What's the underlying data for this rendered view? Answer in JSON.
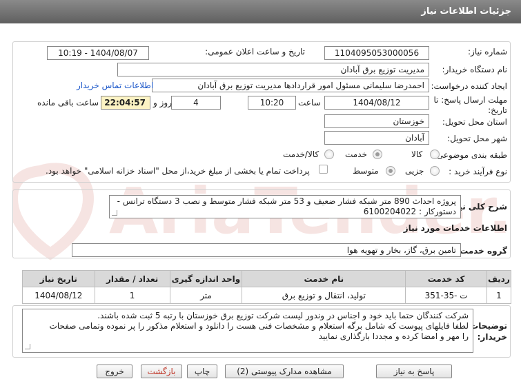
{
  "title": "جزئیات اطلاعات نیاز",
  "fields": {
    "need_number_label": "شماره نیاز:",
    "need_number": "1104095053000056",
    "announce_label": "تاریخ و ساعت اعلان عمومی:",
    "announce_value": "1404/08/07 - 10:19",
    "buyer_org_label": "نام دستگاه خریدار:",
    "buyer_org": "مدیریت توزیع برق آبادان",
    "creator_label": "ایجاد کننده درخواست:",
    "creator": "احمدرضا سلیمانی مسئول امور قراردادها مدیریت توزیع برق آبادان",
    "contact_link": "اطلاعات تماس خریدار",
    "deadline_label": "مهلت ارسال پاسخ: تا تاریخ:",
    "deadline_date": "1404/08/12",
    "hour_label": "ساعت",
    "deadline_time": "10:20",
    "days": "4",
    "days_label": "روز و",
    "remaining": "22:04:57",
    "remaining_label": "ساعت باقی مانده",
    "province_label": "استان محل تحویل:",
    "province": "خوزستان",
    "city_label": "شهر محل تحویل:",
    "city": "آبادان",
    "category_label": "طبقه بندی موضوعی:",
    "category_options": [
      "کالا",
      "خدمت",
      "کالا/خدمت"
    ],
    "category_selected": "خدمت",
    "process_label": "نوع فرآیند خرید :",
    "process_options": [
      "جزیی",
      "متوسط"
    ],
    "process_selected": "متوسط",
    "payment_note": "پرداخت تمام یا بخشی از مبلغ خرید،از محل \"اسناد خزانه اسلامی\" خواهد بود."
  },
  "summary": {
    "label": "شرح کلی نیاز:",
    "text": "پروژه احداث 890 متر شبکه فشار ضعیف و 53 متر شبکه فشار متوسط و نصب 3 دستگاه ترانس - دستورکار : 6100204022"
  },
  "services_header": "اطلاعات خدمات مورد نیاز",
  "service_group_label": "گروه خدمت:",
  "service_group": "تامین برق، گاز، بخار و تهویه هوا",
  "table": {
    "headers": [
      "ردیف",
      "کد خدمت",
      "نام خدمت",
      "واحد اندازه گیری",
      "تعداد / مقدار",
      "تاریخ نیاز"
    ],
    "rows": [
      [
        "1",
        "ت -35-351",
        "تولید، انتقال و توزیع برق",
        "متر",
        "1",
        "1404/08/12"
      ]
    ]
  },
  "buyer_notes": {
    "label": "توضیحات خریدار:",
    "line1": "شرکت کنندگان حتما باید خود و اجناس در وندور لیست شرکت توزیع برق خوزستان با رتبه 5 ثبت شده باشند.",
    "line2": "لطفا فایلهای پیوست که شامل برگه استعلام و مشخصات فنی هست را دانلود و استعلام مذکور را پر نموده وتمامی صفحات",
    "line3": "را مهر و امضا کرده و مجددا بارگذاری نمایید"
  },
  "buttons": {
    "reply": "پاسخ به نیاز",
    "attachments": "مشاهده مدارک پیوستی (2)",
    "print": "چاپ",
    "back": "بازگشت",
    "exit": "خروج"
  },
  "watermark_text": "AriaTender.net",
  "colors": {
    "titlebar": "#6f6f6f",
    "link": "#1a56c9",
    "back_text": "#c0392b",
    "watermark": "#c0392b"
  }
}
